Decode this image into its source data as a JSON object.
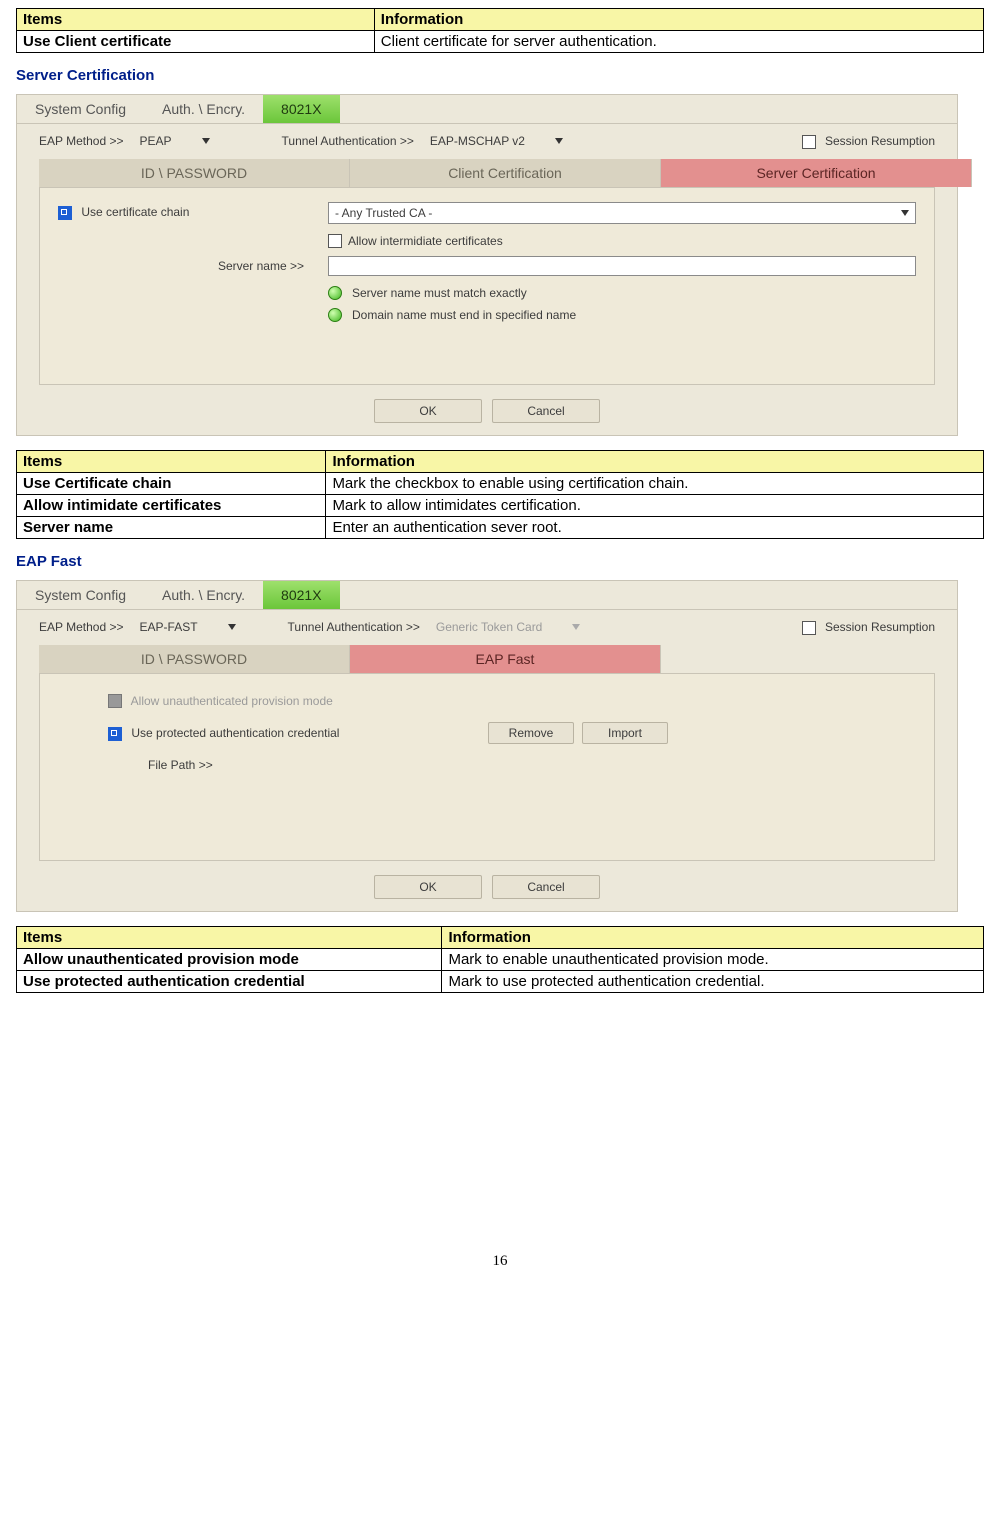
{
  "table1": {
    "headers": [
      "Items",
      "Information"
    ],
    "rows": [
      [
        "Use Client certificate",
        "Client certificate for server authentication."
      ]
    ]
  },
  "section1": "Server Certification",
  "ui1": {
    "topTabs": [
      "System Config",
      "Auth. \\ Encry.",
      "8021X"
    ],
    "eapMethodLabel": "EAP Method >>",
    "eapMethodValue": "PEAP",
    "tunnelLabel": "Tunnel Authentication >>",
    "tunnelValue": "EAP-MSCHAP v2",
    "sessionLabel": "Session Resumption",
    "subTabs": [
      "ID \\ PASSWORD",
      "Client Certification",
      "Server Certification"
    ],
    "useCertChain": "Use certificate chain",
    "anyTrusted": "- Any Trusted CA -",
    "allowInter": "Allow intermidiate certificates",
    "serverNameLabel": "Server name >>",
    "opt1": "Server name must match exactly",
    "opt2": "Domain name must end in specified name",
    "ok": "OK",
    "cancel": "Cancel"
  },
  "table2": {
    "headers": [
      "Items",
      "Information"
    ],
    "rows": [
      [
        "Use Certificate chain",
        "Mark the checkbox to enable using certification chain."
      ],
      [
        "Allow intimidate certificates",
        "Mark to allow intimidates certification."
      ],
      [
        "Server name",
        "Enter an authentication sever root."
      ]
    ]
  },
  "section2": "EAP Fast",
  "ui2": {
    "topTabs": [
      "System Config",
      "Auth. \\ Encry.",
      "8021X"
    ],
    "eapMethodLabel": "EAP Method >>",
    "eapMethodValue": "EAP-FAST",
    "tunnelLabel": "Tunnel Authentication >>",
    "tunnelValue": "Generic Token Card",
    "sessionLabel": "Session Resumption",
    "subTabs": [
      "ID \\ PASSWORD",
      "EAP Fast"
    ],
    "allowUnauth": "Allow unauthenticated provision mode",
    "useProtected": "Use protected authentication credential",
    "remove": "Remove",
    "import": "Import",
    "filePath": "File Path >>",
    "ok": "OK",
    "cancel": "Cancel"
  },
  "table3": {
    "headers": [
      "Items",
      "Information"
    ],
    "rows": [
      [
        "Allow unauthenticated provision mode",
        "Mark to enable unauthenticated provision mode."
      ],
      [
        "Use protected authentication credential",
        "Mark to use protected authentication credential."
      ]
    ]
  },
  "pageNumber": "16"
}
